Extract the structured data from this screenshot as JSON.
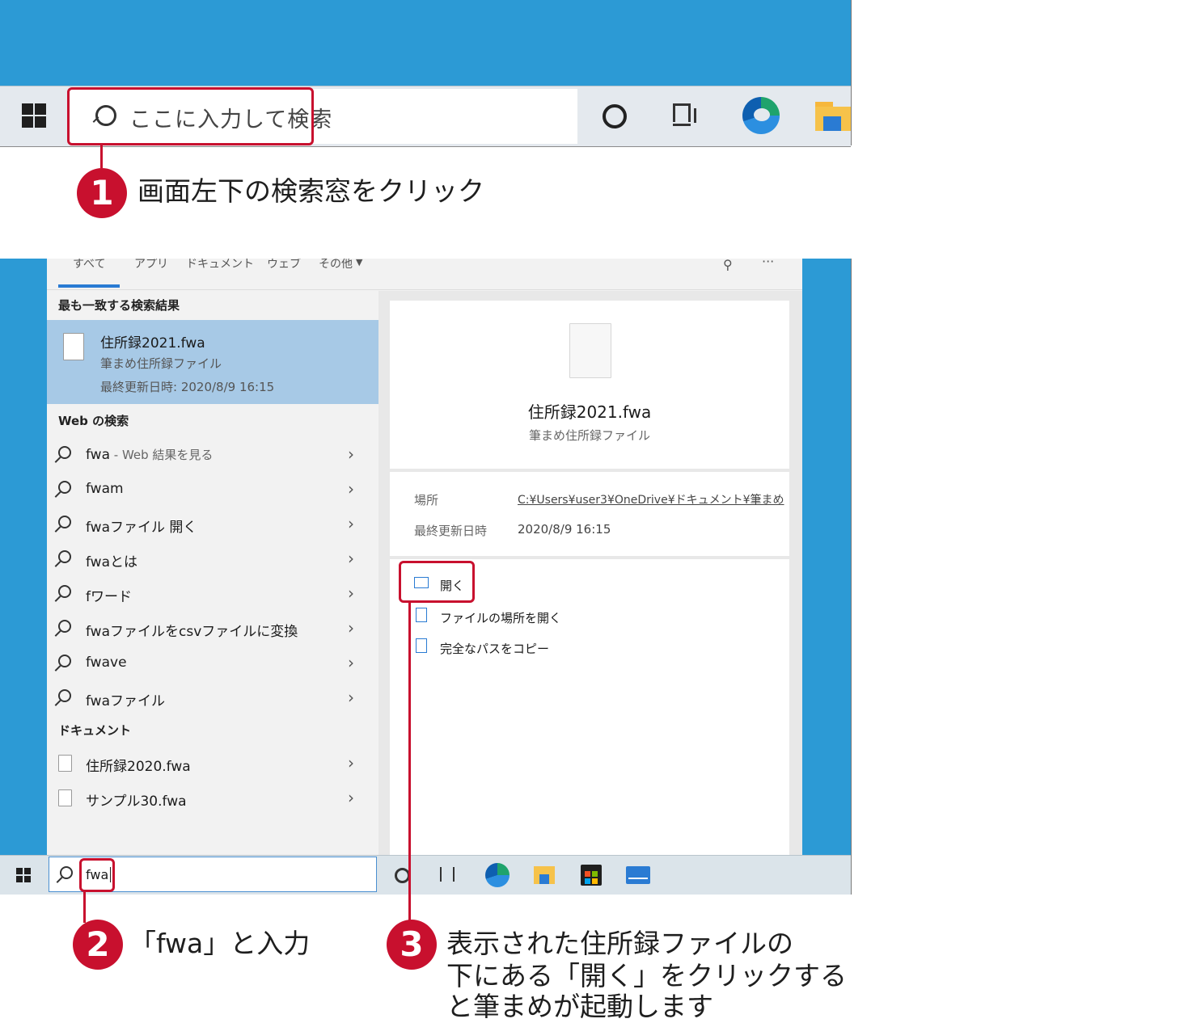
{
  "top": {
    "search_placeholder": "ここに入力して検索"
  },
  "callouts": {
    "c1_num": "1",
    "c1_text": "画面左下の検索窓をクリック",
    "c2_num": "2",
    "c2_text": "「fwa」と入力",
    "c3_num": "3",
    "c3_line1": "表示された住所録ファイルの",
    "c3_line2": "下にある「開く」をクリックする",
    "c3_line3": "と筆まめが起動します"
  },
  "tabs": [
    "すべて",
    "アプリ",
    "ドキュメント",
    "ウェブ",
    "その他"
  ],
  "best_match": {
    "header": "最も一致する検索結果",
    "name": "住所録2021.fwa",
    "type": "筆まめ住所録ファイル",
    "modified": "最終更新日時: 2020/8/9 16:15"
  },
  "web": {
    "header": "Web の検索",
    "items": [
      {
        "label": "fwa",
        "sub": " - Web 結果を見る"
      },
      {
        "label": "fwam",
        "sub": ""
      },
      {
        "label": "fwaファイル 開く",
        "sub": ""
      },
      {
        "label": "fwaとは",
        "sub": ""
      },
      {
        "label": "fワード",
        "sub": ""
      },
      {
        "label": "fwaファイルをcsvファイルに変換",
        "sub": ""
      },
      {
        "label": "fwave",
        "sub": ""
      },
      {
        "label": "fwaファイル",
        "sub": ""
      }
    ]
  },
  "documents": {
    "header": "ドキュメント",
    "items": [
      "住所録2020.fwa",
      "サンプル30.fwa"
    ]
  },
  "detail": {
    "name": "住所録2021.fwa",
    "type": "筆まめ住所録ファイル",
    "location_label": "場所",
    "location_value": "C:¥Users¥user3¥OneDrive¥ドキュメント¥筆まめ",
    "modified_label": "最終更新日時",
    "modified_value": "2020/8/9 16:15",
    "actions": [
      "開く",
      "ファイルの場所を開く",
      "完全なパスをコピー"
    ]
  },
  "search2_value": "fwa",
  "colors": {
    "accent_red": "#c8102e",
    "desktop_blue": "#2c9ad5",
    "selection": "#a7c9e6"
  }
}
